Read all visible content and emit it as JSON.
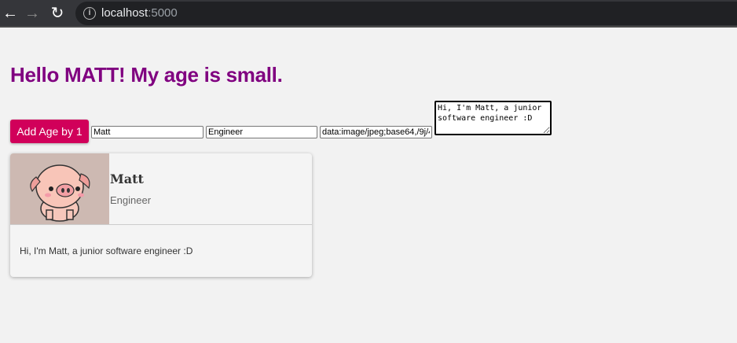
{
  "browser": {
    "url_host": "localhost",
    "url_port": ":5000"
  },
  "heading": "Hello MATT! My age is small.",
  "controls": {
    "add_age_label": "Add Age by 1",
    "name_value": "Matt",
    "job_value": "Engineer",
    "image_value": "data:image/jpeg;base64,/9j/4...",
    "description_value": "Hi, I'm Matt, a junior software engineer :D"
  },
  "card": {
    "name": "Matt",
    "job": "Engineer",
    "description": "Hi, I'm Matt, a junior software engineer :D"
  },
  "colors": {
    "heading": "#800080",
    "button": "#d1005a"
  }
}
